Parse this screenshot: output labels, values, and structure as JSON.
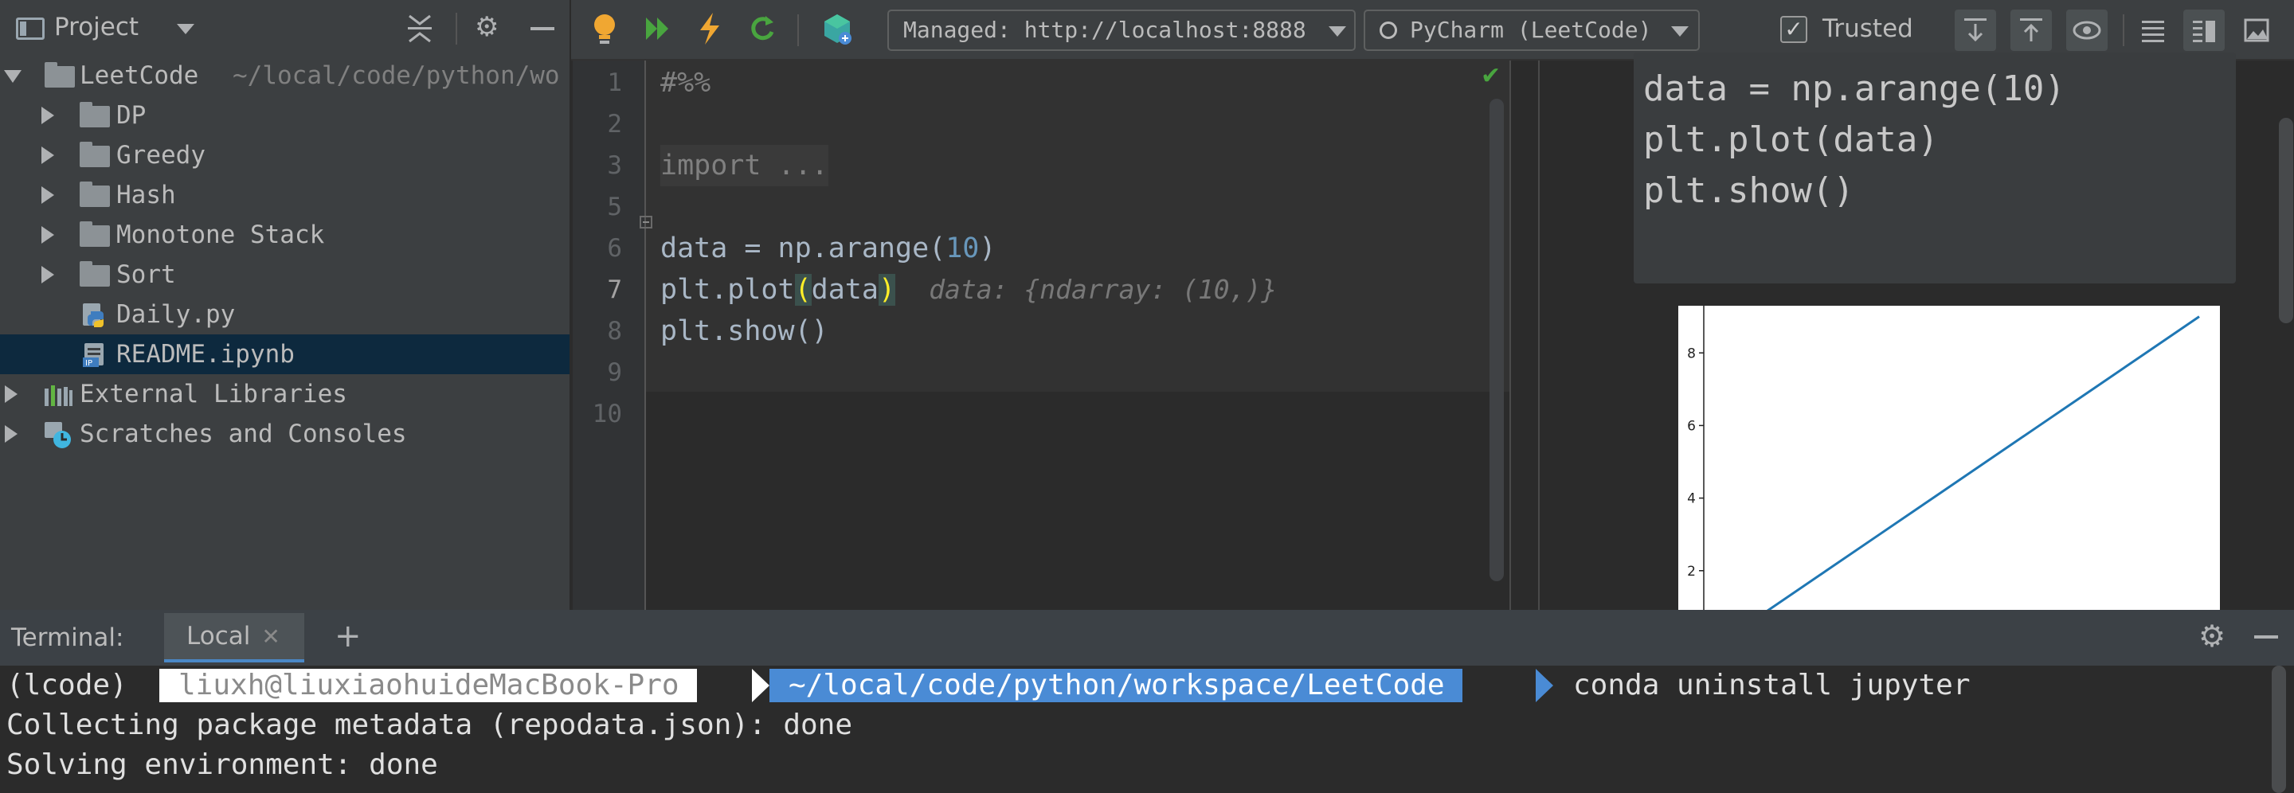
{
  "project_panel": {
    "title": "Project",
    "tree": [
      {
        "label": "LeetCode",
        "path": "~/local/code/python/wo",
        "type": "root"
      },
      {
        "label": "DP",
        "type": "folder"
      },
      {
        "label": "Greedy",
        "type": "folder"
      },
      {
        "label": "Hash",
        "type": "folder"
      },
      {
        "label": "Monotone Stack",
        "type": "folder"
      },
      {
        "label": "Sort",
        "type": "folder"
      },
      {
        "label": "Daily.py",
        "type": "python-file"
      },
      {
        "label": "README.ipynb",
        "type": "notebook-file",
        "selected": true
      },
      {
        "label": "External Libraries",
        "type": "libraries"
      },
      {
        "label": "Scratches and Consoles",
        "type": "scratches"
      }
    ]
  },
  "toolbar": {
    "server_combo": "Managed: http://localhost:8888",
    "kernel_combo": "PyCharm (LeetCode)",
    "trusted_label": "Trusted",
    "trusted_checked": true
  },
  "editor": {
    "line_numbers": [
      "1",
      "2",
      "3",
      "5",
      "6",
      "7",
      "8",
      "9",
      "10"
    ],
    "current_line": "7",
    "code": {
      "l1": "#%%",
      "l3": "import ...",
      "l6_pre": "data = np.arange(",
      "l6_num": "10",
      "l6_post": ")",
      "l7_pre": "plt.plot",
      "l7_open": "(",
      "l7_arg": "data",
      "l7_close": ")",
      "l7_hint": "data: {ndarray: (10,)}",
      "l8": "plt.show()"
    },
    "status": "ok"
  },
  "preview": {
    "code_lines": [
      "data = np.arange(10)",
      "plt.plot(data)",
      "plt.show()"
    ],
    "plot": {
      "ytick_labels": [
        "8",
        "6",
        "4",
        "2"
      ]
    }
  },
  "chart_data": {
    "type": "line",
    "x": [
      0,
      1,
      2,
      3,
      4,
      5,
      6,
      7,
      8,
      9
    ],
    "series": [
      {
        "values": [
          0,
          1,
          2,
          3,
          4,
          5,
          6,
          7,
          8,
          9
        ],
        "color": "#1f77b4"
      }
    ],
    "yticks": [
      2,
      4,
      6,
      8
    ]
  },
  "terminal": {
    "title": "Terminal:",
    "tab_label": "Local",
    "prompt_env": "(lcode)",
    "prompt_user": "liuxh@liuxiaohuideMacBook-Pro",
    "prompt_path": "~/local/code/python/workspace/LeetCode",
    "prompt_command": "conda uninstall jupyter",
    "output": [
      "Collecting package metadata (repodata.json): done",
      "Solving environment: done"
    ]
  },
  "colors": {
    "accent_blue": "#4a8bd5",
    "selected_row": "#0d293e",
    "run_green": "#49a53f",
    "bulb_orange": "#f0a732"
  }
}
